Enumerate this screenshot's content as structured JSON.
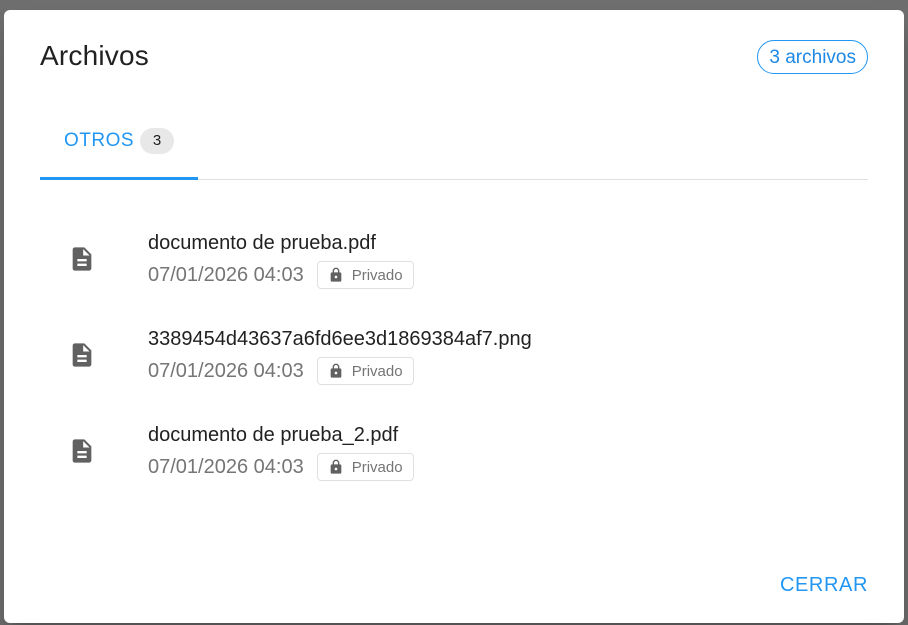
{
  "dialog": {
    "title": "Archivos",
    "count_label": "3 archivos",
    "close_label": "CERRAR"
  },
  "tabs": [
    {
      "label": "OTROS",
      "badge": "3",
      "active": true
    }
  ],
  "files": [
    {
      "name": "documento de prueba.pdf",
      "date": "07/01/2026 04:03",
      "privacy": "Privado",
      "icon": "document-icon"
    },
    {
      "name": "3389454d43637a6fd6ee3d1869384af7.png",
      "date": "07/01/2026 04:03",
      "privacy": "Privado",
      "icon": "document-icon"
    },
    {
      "name": "documento de prueba_2.pdf",
      "date": "07/01/2026 04:03",
      "privacy": "Privado",
      "icon": "document-icon"
    }
  ],
  "colors": {
    "accent": "#2196f3",
    "text_primary": "#212121",
    "text_secondary": "#757575",
    "icon": "#616161",
    "backdrop": "#6f6f6f"
  }
}
